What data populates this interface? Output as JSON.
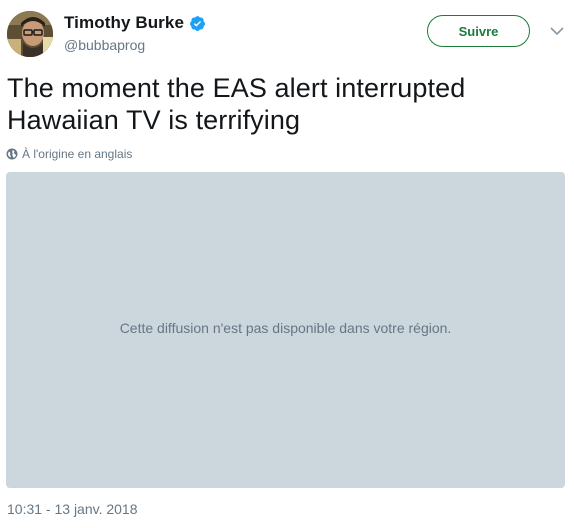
{
  "author": {
    "display_name": "Timothy Burke",
    "handle": "@bubbaprog",
    "verified": true
  },
  "actions": {
    "follow_label": "Suivre",
    "accent_color": "#1b7c3a"
  },
  "tweet": {
    "text": "The moment the EAS alert interrupted Hawaiian TV is terrifying",
    "translation_note": "À l'origine en anglais",
    "media_message": "Cette diffusion n'est pas disponible dans votre région.",
    "timestamp": "10:31 - 13 janv. 2018"
  },
  "icons": {
    "verified": "verified-badge-icon",
    "globe": "globe-icon",
    "menu": "chevron-down-icon"
  },
  "colors": {
    "verified_blue": "#1da1f2",
    "media_background": "#ccd6dd",
    "secondary_text": "#657786"
  }
}
